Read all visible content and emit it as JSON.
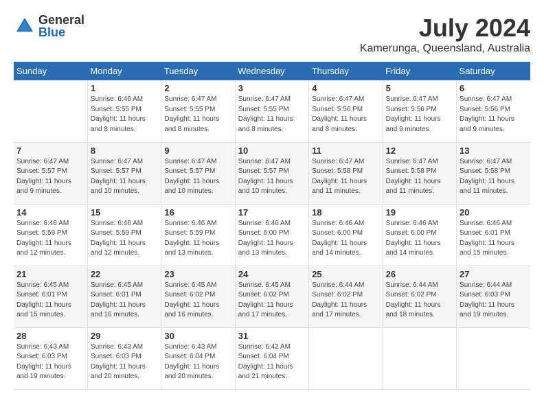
{
  "header": {
    "logo_general": "General",
    "logo_blue": "Blue",
    "title": "July 2024",
    "subtitle": "Kamerunga, Queensland, Australia"
  },
  "days_of_week": [
    "Sunday",
    "Monday",
    "Tuesday",
    "Wednesday",
    "Thursday",
    "Friday",
    "Saturday"
  ],
  "weeks": [
    [
      {
        "day": "",
        "info": ""
      },
      {
        "day": "1",
        "info": "Sunrise: 6:46 AM\nSunset: 5:55 PM\nDaylight: 11 hours and 8 minutes."
      },
      {
        "day": "2",
        "info": "Sunrise: 6:47 AM\nSunset: 5:55 PM\nDaylight: 11 hours and 8 minutes."
      },
      {
        "day": "3",
        "info": "Sunrise: 6:47 AM\nSunset: 5:55 PM\nDaylight: 11 hours and 8 minutes."
      },
      {
        "day": "4",
        "info": "Sunrise: 6:47 AM\nSunset: 5:56 PM\nDaylight: 11 hours and 8 minutes."
      },
      {
        "day": "5",
        "info": "Sunrise: 6:47 AM\nSunset: 5:56 PM\nDaylight: 11 hours and 9 minutes."
      },
      {
        "day": "6",
        "info": "Sunrise: 6:47 AM\nSunset: 5:56 PM\nDaylight: 11 hours and 9 minutes."
      }
    ],
    [
      {
        "day": "7",
        "info": "Sunrise: 6:47 AM\nSunset: 5:57 PM\nDaylight: 11 hours and 9 minutes."
      },
      {
        "day": "8",
        "info": "Sunrise: 6:47 AM\nSunset: 5:57 PM\nDaylight: 11 hours and 10 minutes."
      },
      {
        "day": "9",
        "info": "Sunrise: 6:47 AM\nSunset: 5:57 PM\nDaylight: 11 hours and 10 minutes."
      },
      {
        "day": "10",
        "info": "Sunrise: 6:47 AM\nSunset: 5:57 PM\nDaylight: 11 hours and 10 minutes."
      },
      {
        "day": "11",
        "info": "Sunrise: 6:47 AM\nSunset: 5:58 PM\nDaylight: 11 hours and 11 minutes."
      },
      {
        "day": "12",
        "info": "Sunrise: 6:47 AM\nSunset: 5:58 PM\nDaylight: 11 hours and 11 minutes."
      },
      {
        "day": "13",
        "info": "Sunrise: 6:47 AM\nSunset: 5:58 PM\nDaylight: 11 hours and 11 minutes."
      }
    ],
    [
      {
        "day": "14",
        "info": "Sunrise: 6:46 AM\nSunset: 5:59 PM\nDaylight: 11 hours and 12 minutes."
      },
      {
        "day": "15",
        "info": "Sunrise: 6:46 AM\nSunset: 5:59 PM\nDaylight: 11 hours and 12 minutes."
      },
      {
        "day": "16",
        "info": "Sunrise: 6:46 AM\nSunset: 5:59 PM\nDaylight: 11 hours and 13 minutes."
      },
      {
        "day": "17",
        "info": "Sunrise: 6:46 AM\nSunset: 6:00 PM\nDaylight: 11 hours and 13 minutes."
      },
      {
        "day": "18",
        "info": "Sunrise: 6:46 AM\nSunset: 6:00 PM\nDaylight: 11 hours and 14 minutes."
      },
      {
        "day": "19",
        "info": "Sunrise: 6:46 AM\nSunset: 6:00 PM\nDaylight: 11 hours and 14 minutes."
      },
      {
        "day": "20",
        "info": "Sunrise: 6:46 AM\nSunset: 6:01 PM\nDaylight: 11 hours and 15 minutes."
      }
    ],
    [
      {
        "day": "21",
        "info": "Sunrise: 6:45 AM\nSunset: 6:01 PM\nDaylight: 11 hours and 15 minutes."
      },
      {
        "day": "22",
        "info": "Sunrise: 6:45 AM\nSunset: 6:01 PM\nDaylight: 11 hours and 16 minutes."
      },
      {
        "day": "23",
        "info": "Sunrise: 6:45 AM\nSunset: 6:02 PM\nDaylight: 11 hours and 16 minutes."
      },
      {
        "day": "24",
        "info": "Sunrise: 6:45 AM\nSunset: 6:02 PM\nDaylight: 11 hours and 17 minutes."
      },
      {
        "day": "25",
        "info": "Sunrise: 6:44 AM\nSunset: 6:02 PM\nDaylight: 11 hours and 17 minutes."
      },
      {
        "day": "26",
        "info": "Sunrise: 6:44 AM\nSunset: 6:02 PM\nDaylight: 11 hours and 18 minutes."
      },
      {
        "day": "27",
        "info": "Sunrise: 6:44 AM\nSunset: 6:03 PM\nDaylight: 11 hours and 19 minutes."
      }
    ],
    [
      {
        "day": "28",
        "info": "Sunrise: 6:43 AM\nSunset: 6:03 PM\nDaylight: 11 hours and 19 minutes."
      },
      {
        "day": "29",
        "info": "Sunrise: 6:43 AM\nSunset: 6:03 PM\nDaylight: 11 hours and 20 minutes."
      },
      {
        "day": "30",
        "info": "Sunrise: 6:43 AM\nSunset: 6:04 PM\nDaylight: 11 hours and 20 minutes."
      },
      {
        "day": "31",
        "info": "Sunrise: 6:42 AM\nSunset: 6:04 PM\nDaylight: 11 hours and 21 minutes."
      },
      {
        "day": "",
        "info": ""
      },
      {
        "day": "",
        "info": ""
      },
      {
        "day": "",
        "info": ""
      }
    ]
  ]
}
